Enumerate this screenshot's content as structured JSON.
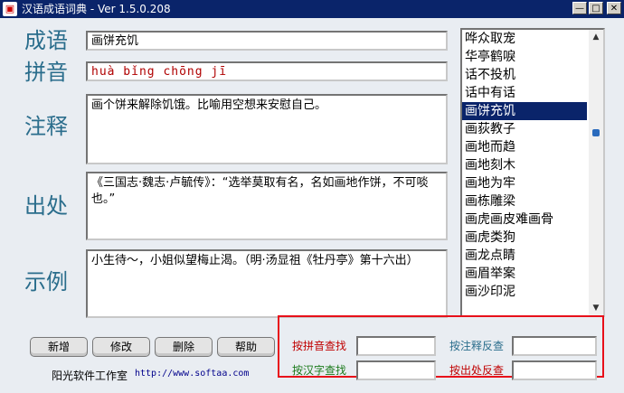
{
  "window": {
    "title": "汉语成语词典 - Ver 1.5.0.208",
    "app_icon": "book-app-icon"
  },
  "labels": {
    "idiom": "成语",
    "pinyin": "拼音",
    "explanation": "注释",
    "source": "出处",
    "example": "示例"
  },
  "fields": {
    "idiom": "画饼充饥",
    "pinyin": "huà  bǐng  chōng  jī",
    "explanation": "画个饼来解除饥饿。比喻用空想来安慰自己。",
    "source": "《三国志·魏志·卢毓传》：“选举莫取有名，名如画地作饼，不可啖也。”",
    "example": "小生待～，小姐似望梅止渴。（明·汤显祖《牡丹亭》第十六出）"
  },
  "idiom_list": {
    "items": [
      "哗众取宠",
      "华亭鹤唳",
      "话不投机",
      "话中有话",
      "画饼充饥",
      "画荻教子",
      "画地而趋",
      "画地刻木",
      "画地为牢",
      "画栋雕梁",
      "画虎画皮难画骨",
      "画虎类狗",
      "画龙点睛",
      "画眉举案",
      "画沙印泥"
    ],
    "selected_index": 4
  },
  "buttons": {
    "add": "新增",
    "edit": "修改",
    "delete": "删除",
    "help": "帮助"
  },
  "footer": {
    "studio": "阳光软件工作室",
    "url": "http://www.softaa.com"
  },
  "search": {
    "by_pinyin": "按拼音查找",
    "by_hanzi": "按汉字查找",
    "by_explanation": "按注释反查",
    "by_source": "按出处反查"
  },
  "colors": {
    "title_bar": "#0a246a",
    "label": "#2a6d8c",
    "pinyin_text": "#b00000",
    "highlight_box": "#e8101a",
    "search_red": "#c00000",
    "search_green": "#1a7a1a",
    "search_teal": "#2a6d8c"
  }
}
